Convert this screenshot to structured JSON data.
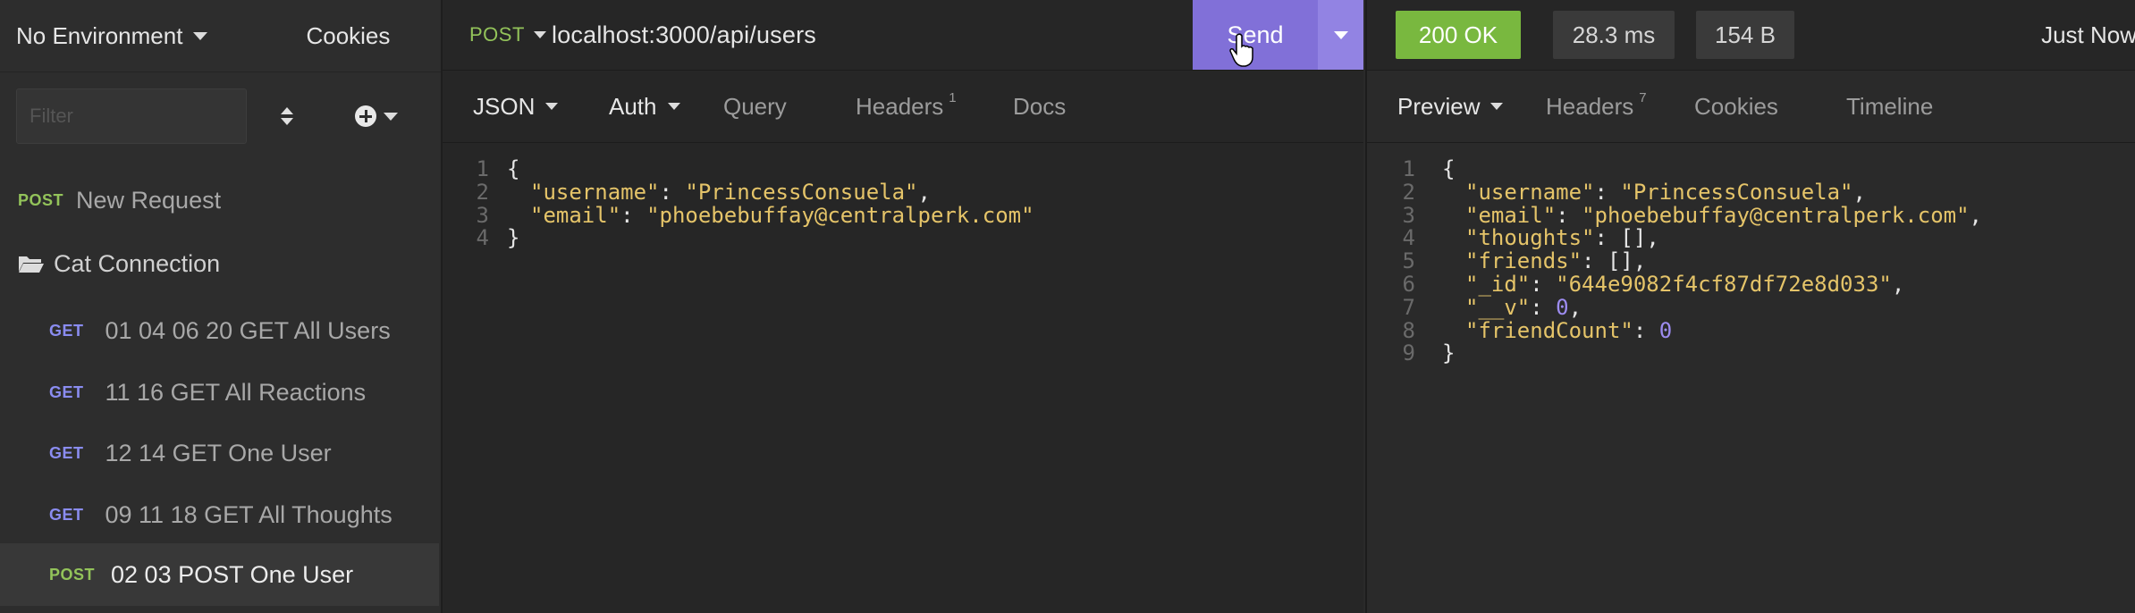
{
  "sidebar": {
    "environment": "No Environment",
    "cookies": "Cookies",
    "filter_placeholder": "Filter",
    "items": [
      {
        "method": "POST",
        "label": "New Request"
      },
      {
        "folder": "Cat Connection"
      },
      {
        "method": "GET",
        "label": "01 04 06 20 GET All Users"
      },
      {
        "method": "GET",
        "label": "11 16 GET All Reactions"
      },
      {
        "method": "GET",
        "label": "12 14 GET One User"
      },
      {
        "method": "GET",
        "label": "09 11 18 GET All Thoughts"
      },
      {
        "method": "POST",
        "label": "02 03 POST One User"
      }
    ]
  },
  "request": {
    "method": "POST",
    "url": "localhost:3000/api/users",
    "send": "Send",
    "tabs": {
      "json": "JSON",
      "auth": "Auth",
      "query": "Query",
      "headers": "Headers",
      "headers_count": "1",
      "docs": "Docs"
    },
    "body_lines": [
      {
        "n": "1",
        "text": "{"
      },
      {
        "n": "2",
        "key": "\"username\"",
        "val": "\"PrincessConsuela\"",
        "tail": ","
      },
      {
        "n": "3",
        "key": "\"email\"",
        "val": "\"phoebebuffay@centralperk.com\"",
        "tail": ""
      },
      {
        "n": "4",
        "text": "}"
      }
    ]
  },
  "response": {
    "status": "200 OK",
    "time": "28.3 ms",
    "size": "154 B",
    "when": "Just Now",
    "tabs": {
      "preview": "Preview",
      "headers": "Headers",
      "headers_count": "7",
      "cookies": "Cookies",
      "timeline": "Timeline"
    },
    "body_lines": [
      {
        "n": "1",
        "text": "{"
      },
      {
        "n": "2",
        "key": "\"username\"",
        "val": "\"PrincessConsuela\"",
        "tail": ","
      },
      {
        "n": "3",
        "key": "\"email\"",
        "val": "\"phoebebuffay@centralperk.com\"",
        "tail": ","
      },
      {
        "n": "4",
        "key": "\"thoughts\"",
        "val": "[]",
        "tail": ","
      },
      {
        "n": "5",
        "key": "\"friends\"",
        "val": "[]",
        "tail": ","
      },
      {
        "n": "6",
        "key": "\"_id\"",
        "val": "\"644e9082f4cf87df72e8d033\"",
        "tail": ","
      },
      {
        "n": "7",
        "key": "\"__v\"",
        "val": "0",
        "tail": ","
      },
      {
        "n": "8",
        "key": "\"friendCount\"",
        "val": "0",
        "tail": ""
      },
      {
        "n": "9",
        "text": "}"
      }
    ]
  },
  "colors": {
    "accent": "#8170d8",
    "ok": "#79b83f",
    "post": "#93c35a",
    "get": "#8a8cf0",
    "json_string": "#e5c469",
    "json_number": "#9d8cf0"
  }
}
